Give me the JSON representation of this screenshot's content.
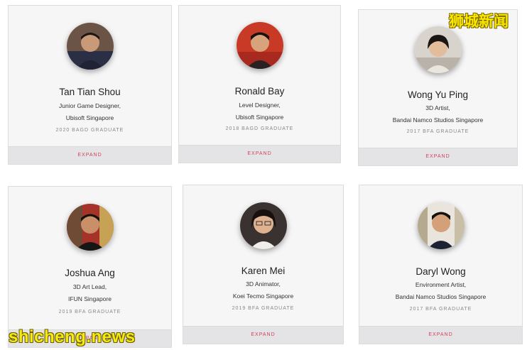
{
  "cards": [
    {
      "name": "Tan Tian Shou",
      "role_line1": "Junior Game Designer,",
      "role_line2": "Ubisoft Singapore",
      "graduate": "2020 BAGD GRADUATE",
      "expand": "EXPAND"
    },
    {
      "name": "Ronald Bay",
      "role_line1": "Level Designer,",
      "role_line2": "Ubisoft Singapore",
      "graduate": "2018 BAGD GRADUATE",
      "expand": "EXPAND"
    },
    {
      "name": "Wong Yu Ping",
      "role_line1": "3D Artist,",
      "role_line2": "Bandai Namco Studios Singapore",
      "graduate": "2017 BFA GRADUATE",
      "expand": "EXPAND"
    },
    {
      "name": "Joshua Ang",
      "role_line1": "3D Art Lead,",
      "role_line2": "IFUN Singapore",
      "graduate": "2019 BFA GRADUATE",
      "expand": "EXPAND"
    },
    {
      "name": "Karen Mei",
      "role_line1": "3D Animator,",
      "role_line2": "Koei Tecmo Singapore",
      "graduate": "2019 BFA GRADUATE",
      "expand": "EXPAND"
    },
    {
      "name": "Daryl Wong",
      "role_line1": "Environment Artist,",
      "role_line2": "Bandai Namco Studios Singapore",
      "graduate": "2017 BFA GRADUATE",
      "expand": "EXPAND"
    }
  ],
  "watermarks": {
    "top_right": "狮城新闻",
    "bottom_left": "shicheng.news"
  }
}
